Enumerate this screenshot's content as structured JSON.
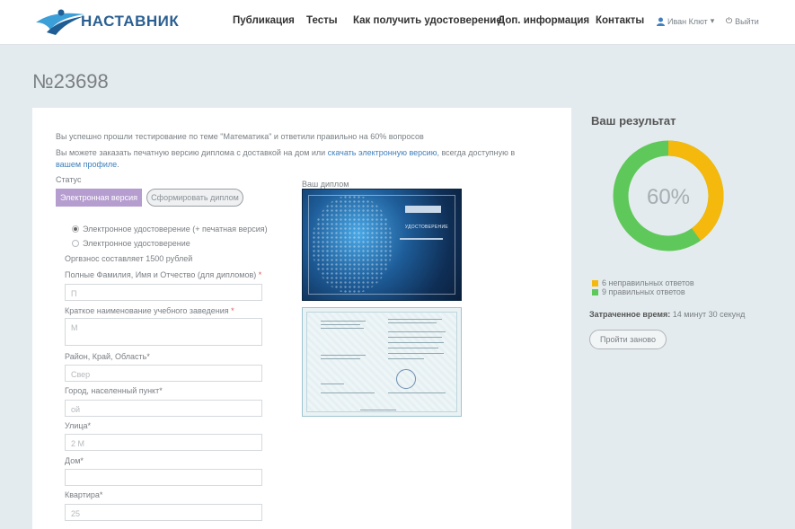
{
  "header": {
    "logo_text": "НАСТАВНИК",
    "nav": [
      "Публикация",
      "Тесты",
      "Как получить удостоверение",
      "Доп. информация",
      "Контакты"
    ],
    "user_name": "Иван Клют",
    "logout_label": "Выйти"
  },
  "page": {
    "title": "№23698"
  },
  "main": {
    "intro": "Вы успешно прошли тестирование по теме \"Математика\" и ответили правильно на 60% вопросов",
    "order_text": "Вы можете заказать печатную версию диплома с доставкой на дом или",
    "order_link": "скачать электронную версию",
    "order_text2": ", всегда доступную в",
    "profile_link": "вашем профиле",
    "profile_after": ".",
    "status_label": "Статус",
    "status_value": "Электронная версия",
    "form_button": "Сформировать диплом",
    "diploma_label": "Ваш диплом",
    "options": [
      {
        "label": "Электронное удостоверение (+ печатная версия)",
        "selected": true
      },
      {
        "label": "Электронное удостоверение",
        "selected": false
      }
    ],
    "fee": "Оргвзнос составляет 1500 рублей",
    "fields": {
      "fio_label": "Полные Фамилия, Имя и Отчество (для дипломов)",
      "fio_value": "П",
      "school_label": "Краткое наименование учебного заведения",
      "school_value": "М",
      "region_label": "Район, Край, Область*",
      "region_value": "Свер",
      "city_label": "Город, населенный пункт*",
      "city_value": "ой",
      "street_label": "Улица*",
      "street_value": "2 М",
      "house_label": "Дом*",
      "house_value": "",
      "apt_label": "Квартира*",
      "apt_value": "25"
    },
    "required_star": "*",
    "diploma_caption": "УДОСТОВЕРЕНИЕ"
  },
  "result": {
    "title": "Ваш результат",
    "percent": "60%",
    "percent_value": 60,
    "wrong_label": "6 неправильных ответов",
    "right_label": "9 правильных ответов",
    "time_label": "Затраченное время:",
    "time_value": "14 минут 30 секунд",
    "retry_label": "Пройти заново"
  },
  "colors": {
    "wrong": "#f5b80d",
    "right": "#5fc85a",
    "accent": "#3e7fbd",
    "status": "#b59dcf"
  }
}
